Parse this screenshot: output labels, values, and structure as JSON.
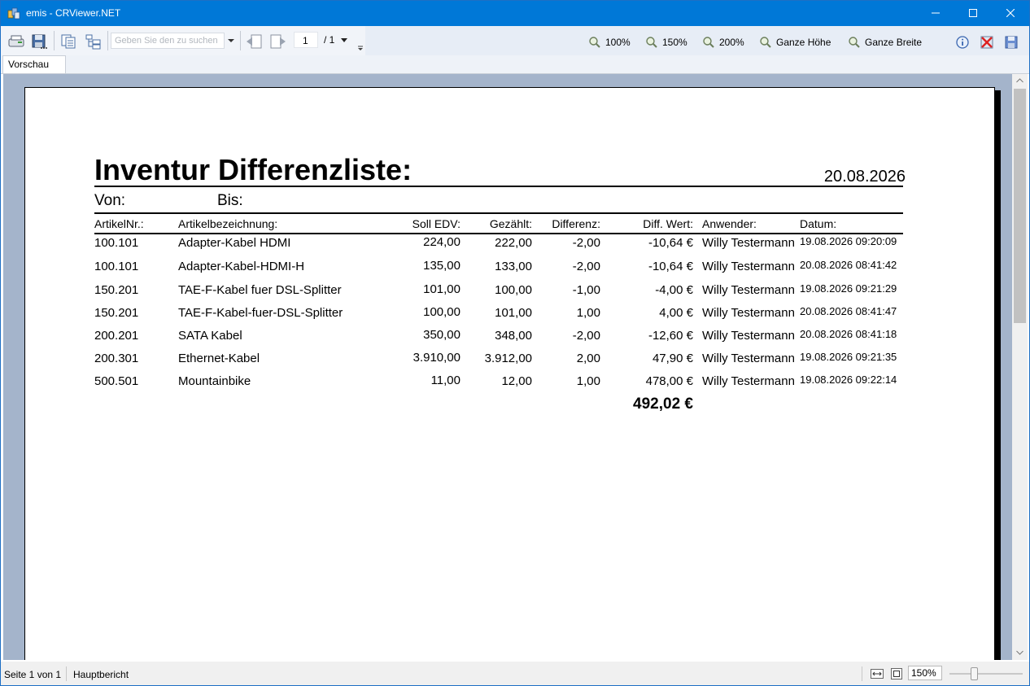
{
  "window": {
    "title": "emis - CRViewer.NET"
  },
  "toolbar": {
    "search_placeholder": "Geben Sie den zu suchen",
    "page_current": "1",
    "page_total": "/ 1",
    "zoom_buttons": [
      "100%",
      "150%",
      "200%",
      "Ganze Höhe",
      "Ganze Breite"
    ]
  },
  "tabs": [
    "Vorschau"
  ],
  "report": {
    "title": "Inventur Differenzliste:",
    "date": "20.08.2026",
    "von_label": "Von:",
    "bis_label": "Bis:",
    "columns": [
      "ArtikelNr.:",
      "Artikelbezeichnung:",
      "Soll EDV:",
      "Gezählt:",
      "Differenz:",
      "Diff. Wert:",
      "Anwender:",
      "Datum:"
    ],
    "rows": [
      [
        "100.101",
        "Adapter-Kabel HDMI",
        "224,00",
        "222,00",
        "-2,00",
        "-10,64 €",
        "Willy Testermann",
        "19.08.2026 09:20:09"
      ],
      [
        "100.101",
        "Adapter-Kabel-HDMI-H",
        "135,00",
        "133,00",
        "-2,00",
        "-10,64 €",
        "Willy Testermann",
        "20.08.2026 08:41:42"
      ],
      [
        "150.201",
        "TAE-F-Kabel fuer DSL-Splitter",
        "101,00",
        "100,00",
        "-1,00",
        "-4,00 €",
        "Willy Testermann",
        "19.08.2026 09:21:29"
      ],
      [
        "150.201",
        "TAE-F-Kabel-fuer-DSL-Splitter",
        "100,00",
        "101,00",
        "1,00",
        "4,00 €",
        "Willy Testermann",
        "20.08.2026 08:41:47"
      ],
      [
        "200.201",
        "SATA Kabel",
        "350,00",
        "348,00",
        "-2,00",
        "-12,60 €",
        "Willy Testermann",
        "20.08.2026 08:41:18"
      ],
      [
        "200.301",
        "Ethernet-Kabel",
        "3.910,00",
        "3.912,00",
        "2,00",
        "47,90 €",
        "Willy Testermann",
        "19.08.2026 09:21:35"
      ],
      [
        "500.501",
        "Mountainbike",
        "11,00",
        "12,00",
        "1,00",
        "478,00 €",
        "Willy Testermann",
        "19.08.2026 09:22:14"
      ]
    ],
    "total": "492,02 €"
  },
  "statusbar": {
    "page_info": "Seite 1 von 1",
    "report_name": "Hauptbericht",
    "zoom": "150%"
  },
  "colors": {
    "titlebar": "#0078d7",
    "viewer_bg": "#a4b4cb"
  }
}
